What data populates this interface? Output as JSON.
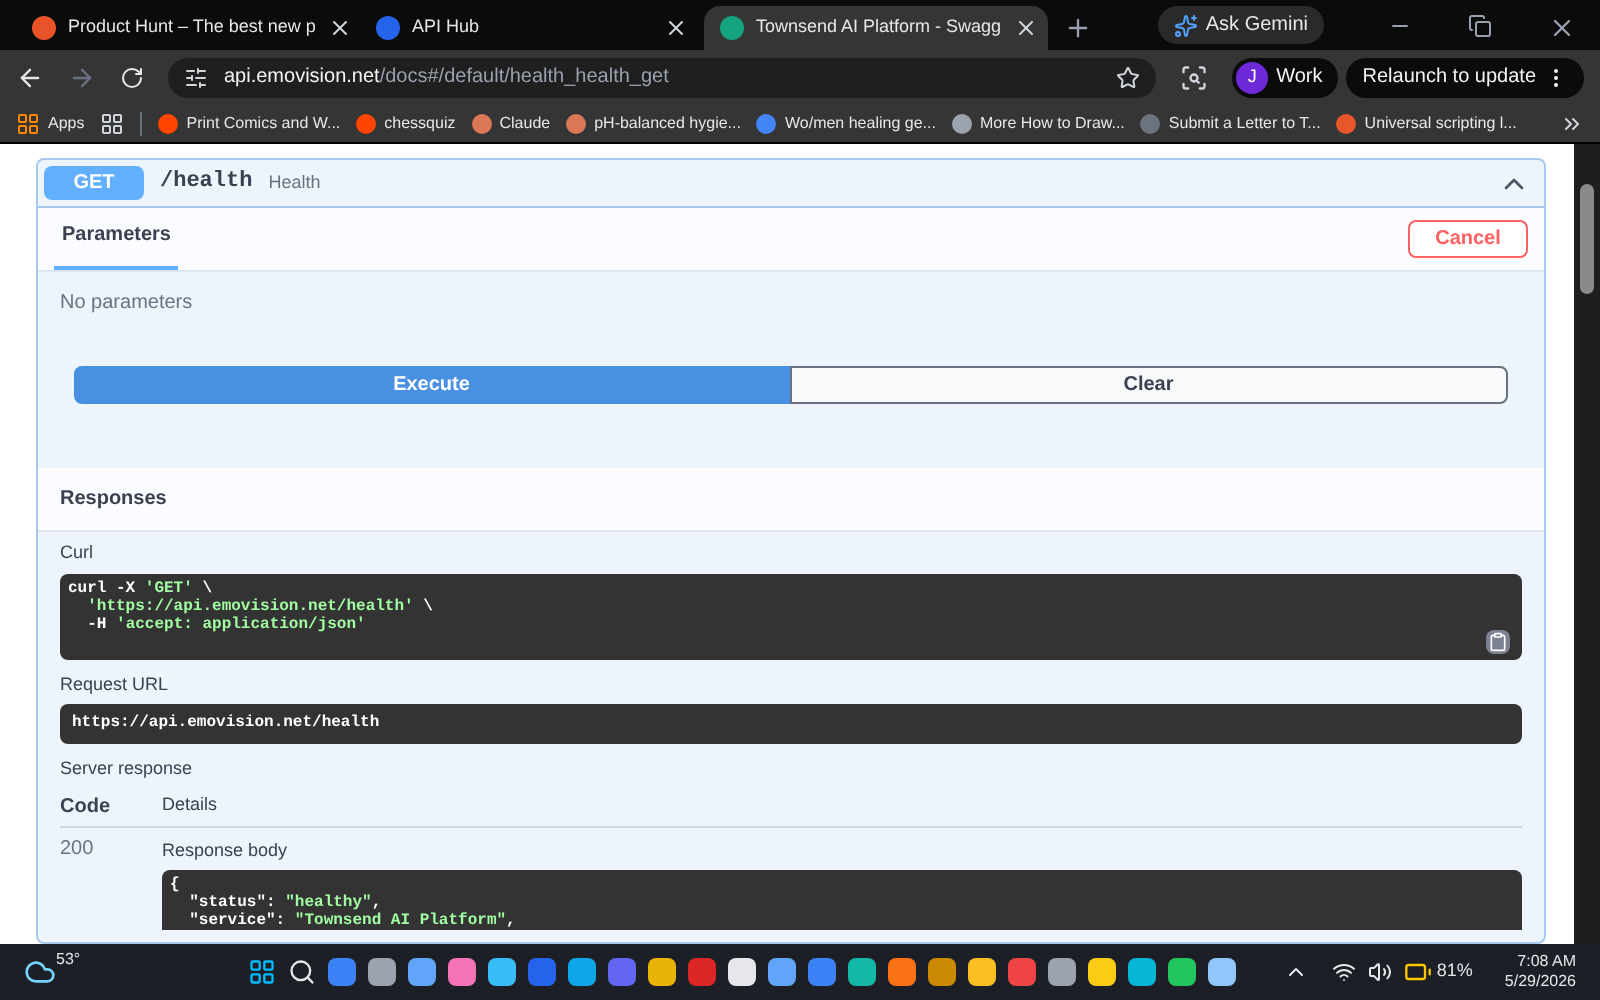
{
  "browser": {
    "tabs": [
      {
        "title": "Product Hunt – The best new p",
        "selected": false,
        "color": "#ea532a"
      },
      {
        "title": "API Hub",
        "selected": false,
        "color": "#2563eb"
      },
      {
        "title": "Townsend AI Platform - Swagg",
        "selected": true,
        "color": "#14a37f"
      }
    ],
    "ask_gemini": "Ask Gemini",
    "address": {
      "host": "api.emovision.net",
      "path": "/docs#/default/health_health_get"
    },
    "profile": {
      "initial": "J",
      "label": "Work"
    },
    "relaunch": "Relaunch to update",
    "bookmarks": [
      {
        "title": "Apps",
        "kind": "apps"
      },
      {
        "title": "Print Comics and W...",
        "kind": "site",
        "color": "#ff4500"
      },
      {
        "title": "chessquiz",
        "kind": "site",
        "color": "#ff4500"
      },
      {
        "title": "Claude",
        "kind": "site",
        "color": "#d97757"
      },
      {
        "title": "pH-balanced hygie...",
        "kind": "site",
        "color": "#d97757"
      },
      {
        "title": "Wo/men healing ge...",
        "kind": "site",
        "color": "#4285f4"
      },
      {
        "title": "More How to Draw...",
        "kind": "site",
        "color": "#9ca3af"
      },
      {
        "title": "Submit a Letter to T...",
        "kind": "site",
        "color": "#6b7280"
      },
      {
        "title": "Universal scripting l...",
        "kind": "site",
        "color": "#e8572a"
      }
    ]
  },
  "operation": {
    "method": "GET",
    "path": "/health",
    "summary": "Health",
    "expanded": true,
    "tabs": [
      {
        "label": "Parameters",
        "selected": true
      }
    ],
    "cancel": "Cancel",
    "no_params": "No parameters",
    "execute": "Execute",
    "clear": "Clear",
    "responses": "Responses",
    "curl_label": "Curl",
    "curl": [
      [
        {
          "t": "curl -X ",
          "kind": "plain"
        },
        {
          "t": "'GET'",
          "kind": "string"
        },
        {
          "t": " \\",
          "kind": "plain"
        }
      ],
      [
        {
          "t": "  'https://api.emovision.net/health'",
          "kind": "string"
        },
        {
          "t": " \\",
          "kind": "plain"
        }
      ],
      [
        {
          "t": "  -H ",
          "kind": "plain"
        },
        {
          "t": "'accept: application/json'",
          "kind": "string"
        }
      ]
    ],
    "request_url_label": "Request URL",
    "request_url": "https://api.emovision.net/health",
    "server_response_label": "Server response",
    "code_header": "Code",
    "details_header": "Details",
    "code": "200",
    "body_label": "Response body",
    "body": [
      [
        {
          "t": "{",
          "kind": "plain"
        }
      ],
      [
        {
          "t": "  \"status\": ",
          "kind": "plain"
        },
        {
          "t": "\"healthy\"",
          "kind": "string"
        },
        {
          "t": ",",
          "kind": "plain"
        }
      ],
      [
        {
          "t": "  \"service\": ",
          "kind": "plain"
        },
        {
          "t": "\"Townsend AI Platform\"",
          "kind": "string"
        },
        {
          "t": ",",
          "kind": "plain"
        }
      ]
    ]
  },
  "taskbar": {
    "weather": "53°",
    "battery": "81%",
    "time": "7:08 AM",
    "date": "5/29/2026"
  }
}
